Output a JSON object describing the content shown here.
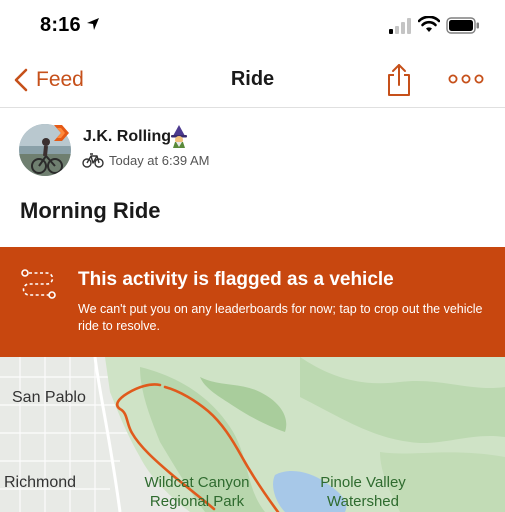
{
  "status_bar": {
    "time": "8:16"
  },
  "nav": {
    "back_label": "Feed",
    "title": "Ride"
  },
  "athlete": {
    "name": "J.K. Rolling",
    "activity_time": "Today at 6:39 AM"
  },
  "activity": {
    "title": "Morning Ride"
  },
  "flag_banner": {
    "title": "This activity is flagged as a vehicle",
    "description": "We can't put you on any leaderboards for now; tap to crop out the vehicle ride to resolve."
  },
  "map": {
    "labels": {
      "san_pablo": "San Pablo",
      "richmond": "Richmond",
      "wildcat": "Wildcat Canyon Regional Park",
      "pinole": "Pinole Valley Watershed"
    }
  },
  "colors": {
    "accent": "#c6501a",
    "banner": "#c8470f",
    "route": "#e05a1c"
  }
}
